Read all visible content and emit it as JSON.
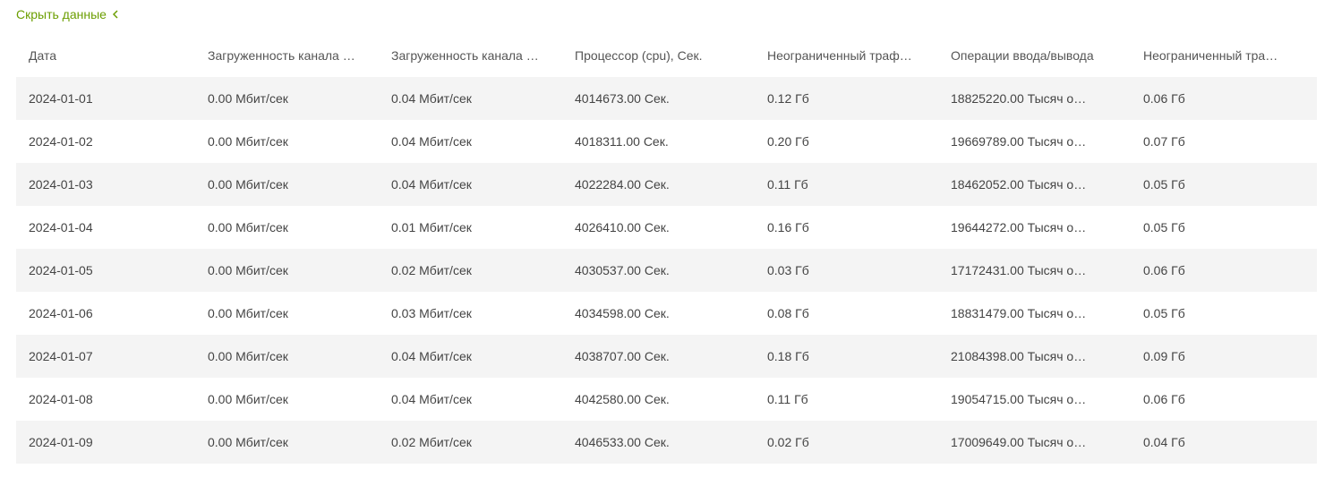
{
  "header": {
    "hide_label": "Скрыть данные"
  },
  "table": {
    "columns": [
      "Дата",
      "Загруженность канала …",
      "Загруженность канала …",
      "Процессор (cpu), Сек.",
      "Неограниченный траф…",
      "Операции ввода/вывода",
      "Неограниченный тра…"
    ],
    "rows": [
      {
        "date": "2024-01-01",
        "chan_a": "0.00 Мбит/сек",
        "chan_b": "0.04 Мбит/сек",
        "cpu": "4014673.00 Сек.",
        "traf_a": "0.12 Гб",
        "io": "18825220.00 Тысяч о…",
        "traf_b": "0.06 Гб"
      },
      {
        "date": "2024-01-02",
        "chan_a": "0.00 Мбит/сек",
        "chan_b": "0.04 Мбит/сек",
        "cpu": "4018311.00 Сек.",
        "traf_a": "0.20 Гб",
        "io": "19669789.00 Тысяч о…",
        "traf_b": "0.07 Гб"
      },
      {
        "date": "2024-01-03",
        "chan_a": "0.00 Мбит/сек",
        "chan_b": "0.04 Мбит/сек",
        "cpu": "4022284.00 Сек.",
        "traf_a": "0.11 Гб",
        "io": "18462052.00 Тысяч о…",
        "traf_b": "0.05 Гб"
      },
      {
        "date": "2024-01-04",
        "chan_a": "0.00 Мбит/сек",
        "chan_b": "0.01 Мбит/сек",
        "cpu": "4026410.00 Сек.",
        "traf_a": "0.16 Гб",
        "io": "19644272.00 Тысяч о…",
        "traf_b": "0.05 Гб"
      },
      {
        "date": "2024-01-05",
        "chan_a": "0.00 Мбит/сек",
        "chan_b": "0.02 Мбит/сек",
        "cpu": "4030537.00 Сек.",
        "traf_a": "0.03 Гб",
        "io": "17172431.00 Тысяч о…",
        "traf_b": "0.06 Гб"
      },
      {
        "date": "2024-01-06",
        "chan_a": "0.00 Мбит/сек",
        "chan_b": "0.03 Мбит/сек",
        "cpu": "4034598.00 Сек.",
        "traf_a": "0.08 Гб",
        "io": "18831479.00 Тысяч о…",
        "traf_b": "0.05 Гб"
      },
      {
        "date": "2024-01-07",
        "chan_a": "0.00 Мбит/сек",
        "chan_b": "0.04 Мбит/сек",
        "cpu": "4038707.00 Сек.",
        "traf_a": "0.18 Гб",
        "io": "21084398.00 Тысяч о…",
        "traf_b": "0.09 Гб"
      },
      {
        "date": "2024-01-08",
        "chan_a": "0.00 Мбит/сек",
        "chan_b": "0.04 Мбит/сек",
        "cpu": "4042580.00 Сек.",
        "traf_a": "0.11 Гб",
        "io": "19054715.00 Тысяч о…",
        "traf_b": "0.06 Гб"
      },
      {
        "date": "2024-01-09",
        "chan_a": "0.00 Мбит/сек",
        "chan_b": "0.02 Мбит/сек",
        "cpu": "4046533.00 Сек.",
        "traf_a": "0.02 Гб",
        "io": "17009649.00 Тысяч о…",
        "traf_b": "0.04 Гб"
      }
    ]
  }
}
